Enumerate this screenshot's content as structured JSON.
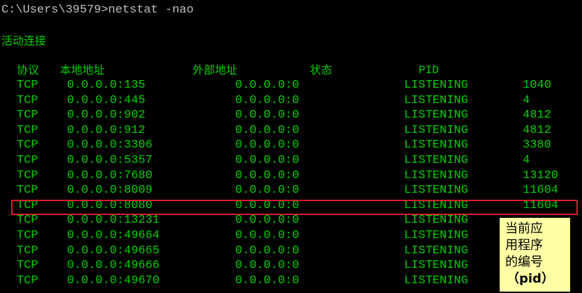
{
  "terminal": {
    "command_line": "C:\\Users\\39579>netstat -nao",
    "section_title": "活动连接",
    "colors": {
      "background": "#000000",
      "command_text": "#c0c0c0",
      "output_text": "#00d000",
      "highlight_border": "#d8202a",
      "callout_bg": "#ffffa6"
    }
  },
  "table": {
    "headers": {
      "proto": "协议",
      "local": "本地地址",
      "foreign": "外部地址",
      "state": "状态",
      "pid": "PID"
    },
    "rows": [
      {
        "proto": "TCP",
        "local": "0.0.0.0:135",
        "foreign": "0.0.0.0:0",
        "state": "LISTENING",
        "pid": "1040"
      },
      {
        "proto": "TCP",
        "local": "0.0.0.0:445",
        "foreign": "0.0.0.0:0",
        "state": "LISTENING",
        "pid": "4"
      },
      {
        "proto": "TCP",
        "local": "0.0.0.0:902",
        "foreign": "0.0.0.0:0",
        "state": "LISTENING",
        "pid": "4812"
      },
      {
        "proto": "TCP",
        "local": "0.0.0.0:912",
        "foreign": "0.0.0.0:0",
        "state": "LISTENING",
        "pid": "4812"
      },
      {
        "proto": "TCP",
        "local": "0.0.0.0:3306",
        "foreign": "0.0.0.0:0",
        "state": "LISTENING",
        "pid": "3380"
      },
      {
        "proto": "TCP",
        "local": "0.0.0.0:5357",
        "foreign": "0.0.0.0:0",
        "state": "LISTENING",
        "pid": "4"
      },
      {
        "proto": "TCP",
        "local": "0.0.0.0:7680",
        "foreign": "0.0.0.0:0",
        "state": "LISTENING",
        "pid": "13120"
      },
      {
        "proto": "TCP",
        "local": "0.0.0.0:8009",
        "foreign": "0.0.0.0:0",
        "state": "LISTENING",
        "pid": "11604"
      },
      {
        "proto": "TCP",
        "local": "0.0.0.0:8080",
        "foreign": "0.0.0.0:0",
        "state": "LISTENING",
        "pid": "11604"
      },
      {
        "proto": "TCP",
        "local": "0.0.0.0:13231",
        "foreign": "0.0.0.0:0",
        "state": "LISTENING",
        "pid": ""
      },
      {
        "proto": "TCP",
        "local": "0.0.0.0:49664",
        "foreign": "0.0.0.0:0",
        "state": "LISTENING",
        "pid": ""
      },
      {
        "proto": "TCP",
        "local": "0.0.0.0:49665",
        "foreign": "0.0.0.0:0",
        "state": "LISTENING",
        "pid": ""
      },
      {
        "proto": "TCP",
        "local": "0.0.0.0:49666",
        "foreign": "0.0.0.0:0",
        "state": "LISTENING",
        "pid": ""
      },
      {
        "proto": "TCP",
        "local": "0.0.0.0:49670",
        "foreign": "0.0.0.0:0",
        "state": "LISTENING",
        "pid": ""
      }
    ]
  },
  "callout": {
    "line1": "当前应",
    "line2": "用程序",
    "line3": "的编号",
    "line4": "（pid）"
  }
}
